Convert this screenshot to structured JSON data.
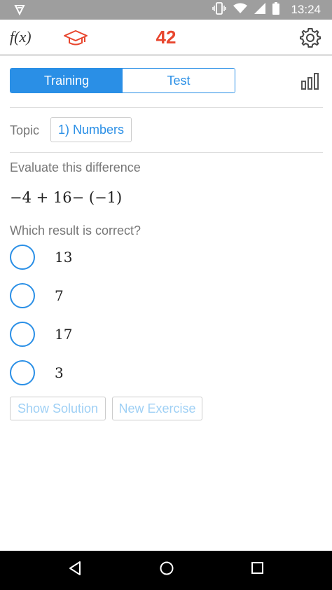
{
  "status_bar": {
    "time": "13:24",
    "icons": [
      "notification-icon",
      "vibrate-icon",
      "wifi-icon",
      "signal-icon",
      "battery-icon"
    ]
  },
  "app_bar": {
    "function_label": "f(x)",
    "score": "42",
    "hat_icon": "graduation-cap-icon",
    "settings_icon": "gear-icon"
  },
  "mode": {
    "training": "Training",
    "test": "Test",
    "selected": "Training"
  },
  "topic": {
    "label": "Topic",
    "value": "1) Numbers"
  },
  "exercise": {
    "prompt": "Evaluate this difference",
    "expression": "−4 + 16− (−1)",
    "question": "Which result is correct?",
    "options": [
      "13",
      "7",
      "17",
      "3"
    ]
  },
  "actions": {
    "show_solution": "Show Solution",
    "new_exercise": "New Exercise"
  },
  "colors": {
    "accent": "#2a8fe6",
    "score": "#e8462e",
    "hat": "#e8462e",
    "status_bar": "#9e9e9e"
  }
}
